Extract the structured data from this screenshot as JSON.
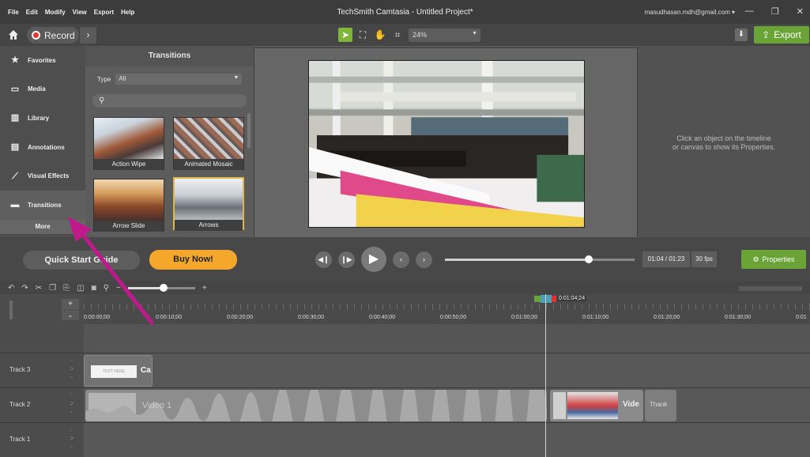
{
  "menu": [
    "File",
    "Edit",
    "Modify",
    "View",
    "Export",
    "Help"
  ],
  "app_title": "TechSmith Camtasia - Untitled Project*",
  "account": "masudhasan.mdh@gmail.com",
  "account_caret": "▾",
  "window": {
    "minimize": "—",
    "restore": "❐",
    "close": "✕"
  },
  "toolbar": {
    "record_label": "Record",
    "zoom": "24%",
    "export_label": "Export"
  },
  "sidebar": {
    "items": [
      {
        "label": "Favorites",
        "icon": "star-icon"
      },
      {
        "label": "Media",
        "icon": "media-icon"
      },
      {
        "label": "Library",
        "icon": "library-icon"
      },
      {
        "label": "Annotations",
        "icon": "annotations-icon"
      },
      {
        "label": "Visual Effects",
        "icon": "visual-effects-icon"
      },
      {
        "label": "Transitions",
        "icon": "transitions-icon"
      }
    ],
    "more_label": "More"
  },
  "transitions": {
    "title": "Transitions",
    "type_label": "Type",
    "type_value": "All",
    "thumbnails": [
      "Action Wipe",
      "Animated Mosaic",
      "Arrow Slide",
      "Arrows"
    ]
  },
  "properties_hint_1": "Click an object on the timeline",
  "properties_hint_2": "or canvas to show its Properties.",
  "controls": {
    "quick_start": "Quick Start Guide",
    "buy_now": "Buy Now!",
    "time": "01:04 / 01:23",
    "fps": "30 fps",
    "properties": "Properties",
    "scrub_progress": 0.76
  },
  "timeline": {
    "playhead_time": "0:01:04;24",
    "ticks": [
      "0:00:00;00",
      "0:00:10;00",
      "0:00:20;00",
      "0:00:30;00",
      "0:00:40;00",
      "0:00:50;00",
      "0:01:00;00",
      "0:01:10;00",
      "0:01:20;00",
      "0:01:30;00",
      "0:01"
    ],
    "tracks": [
      {
        "name": "Track 3",
        "clip_label": "Ca"
      },
      {
        "name": "Track 2",
        "clip_label": "Video 1",
        "clip2_label": "Vide",
        "clip3_label": "Thank"
      },
      {
        "name": "Track 1"
      }
    ]
  },
  "colors": {
    "accent_green": "#6aa437",
    "record_red": "#e8342b",
    "buy_orange": "#f4a72b",
    "arrow_magenta": "#c0198c"
  }
}
